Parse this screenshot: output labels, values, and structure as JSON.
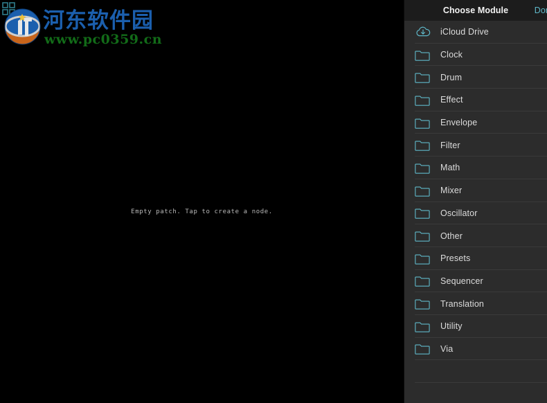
{
  "canvas": {
    "empty_text": "Empty patch. Tap to create a node.",
    "background_color": "#000000"
  },
  "watermark": {
    "cn_text": "河东软件园",
    "url_text": "www.pc0359.cn",
    "cn_color": "#1b5fae",
    "url_color": "#126b18",
    "grid_icon_name": "grid-squares-icon",
    "grid_icon_color": "#2f7d8c",
    "logo_top_color": "#1b5fae",
    "logo_bottom_color": "#c8641a"
  },
  "panel": {
    "title": "Choose Module",
    "done_label": "Done",
    "done_color": "#5fb8c9",
    "background_color": "#2c2c2c",
    "header_color": "#1c1c1c",
    "separator_color": "#3a3a3a",
    "icon_color": "#5fb8c9",
    "items": [
      {
        "label": "iCloud Drive",
        "icon": "icloud-download-icon"
      },
      {
        "label": "Clock",
        "icon": "folder-icon"
      },
      {
        "label": "Drum",
        "icon": "folder-icon"
      },
      {
        "label": "Effect",
        "icon": "folder-icon"
      },
      {
        "label": "Envelope",
        "icon": "folder-icon"
      },
      {
        "label": "Filter",
        "icon": "folder-icon"
      },
      {
        "label": "Math",
        "icon": "folder-icon"
      },
      {
        "label": "Mixer",
        "icon": "folder-icon"
      },
      {
        "label": "Oscillator",
        "icon": "folder-icon"
      },
      {
        "label": "Other",
        "icon": "folder-icon"
      },
      {
        "label": "Presets",
        "icon": "folder-icon"
      },
      {
        "label": "Sequencer",
        "icon": "folder-icon"
      },
      {
        "label": "Translation",
        "icon": "folder-icon"
      },
      {
        "label": "Utility",
        "icon": "folder-icon"
      },
      {
        "label": "Via",
        "icon": "folder-icon"
      },
      {
        "label": "",
        "icon": "none"
      },
      {
        "label": "",
        "icon": "none"
      }
    ]
  }
}
